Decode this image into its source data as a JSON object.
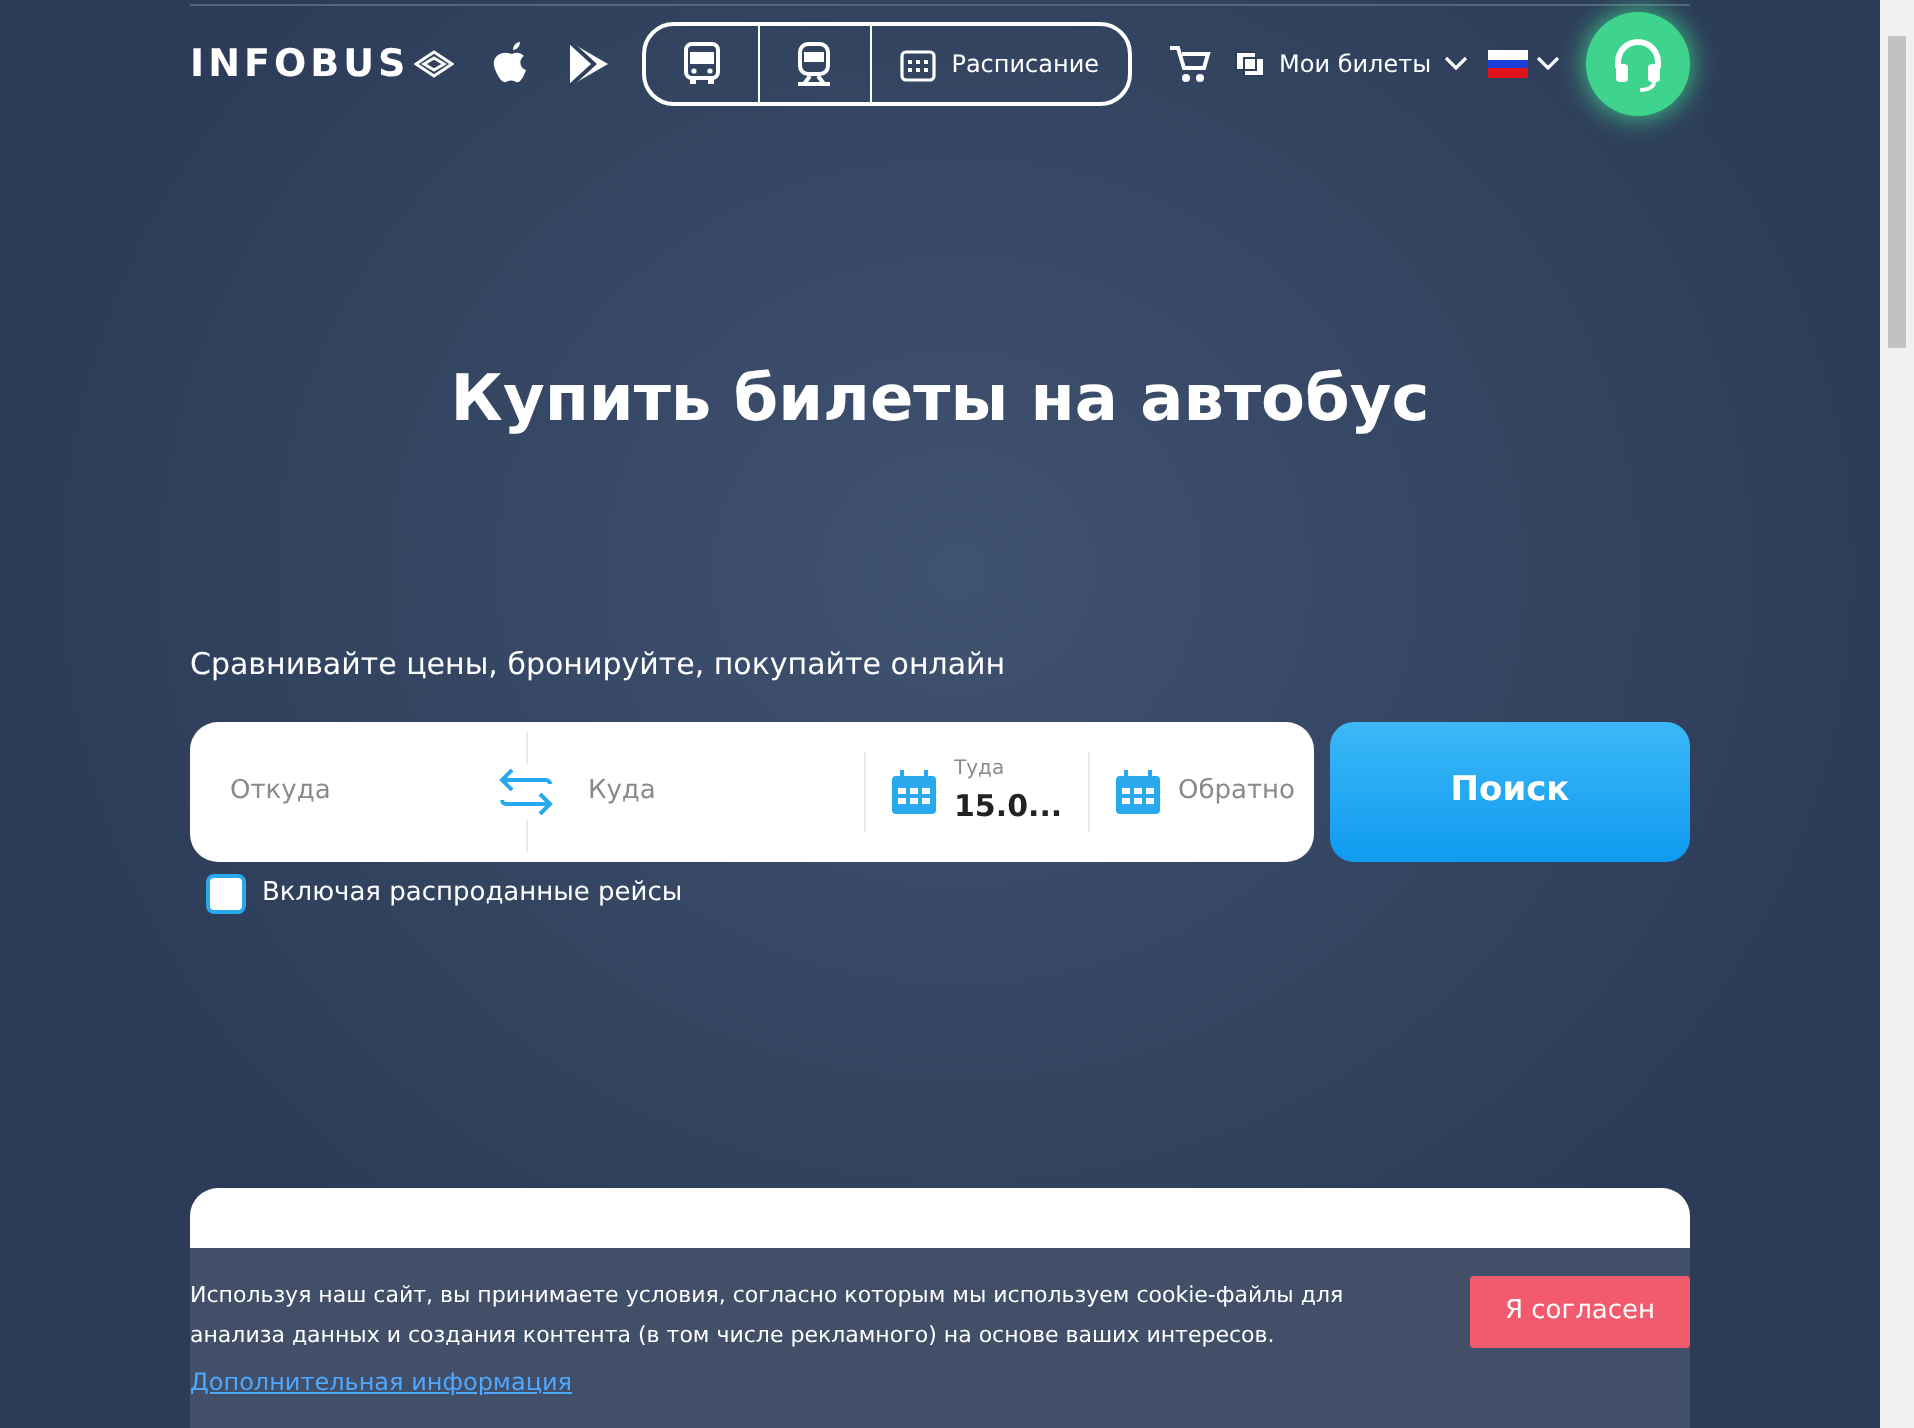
{
  "header": {
    "logo": "INFOBUS",
    "transport_tabs": [
      {
        "kind": "bus"
      },
      {
        "kind": "train"
      },
      {
        "kind": "schedule",
        "label": "Расписание"
      }
    ],
    "my_tickets": "Мои билеты"
  },
  "hero": {
    "title": "Купить билеты на автобус",
    "subtitle": "Сравнивайте цены, бронируйте, покупайте онлайн"
  },
  "search": {
    "from": {
      "placeholder": "Откуда"
    },
    "to": {
      "placeholder": "Куда"
    },
    "depart": {
      "label": "Туда",
      "value": "15.0..."
    },
    "return": {
      "placeholder": "Обратно"
    },
    "button": "Поиск"
  },
  "sold_out_option": {
    "label": "Включая распроданные рейсы",
    "checked": false
  },
  "cookie_banner": {
    "text": "Используя наш сайт, вы принимаете условия, согласно которым мы используем cookie-файлы для анализа данных и создания контента (в том числе рекламного) на основе ваших интересов.",
    "link": "Дополнительная информация",
    "button": "Я согласен"
  }
}
